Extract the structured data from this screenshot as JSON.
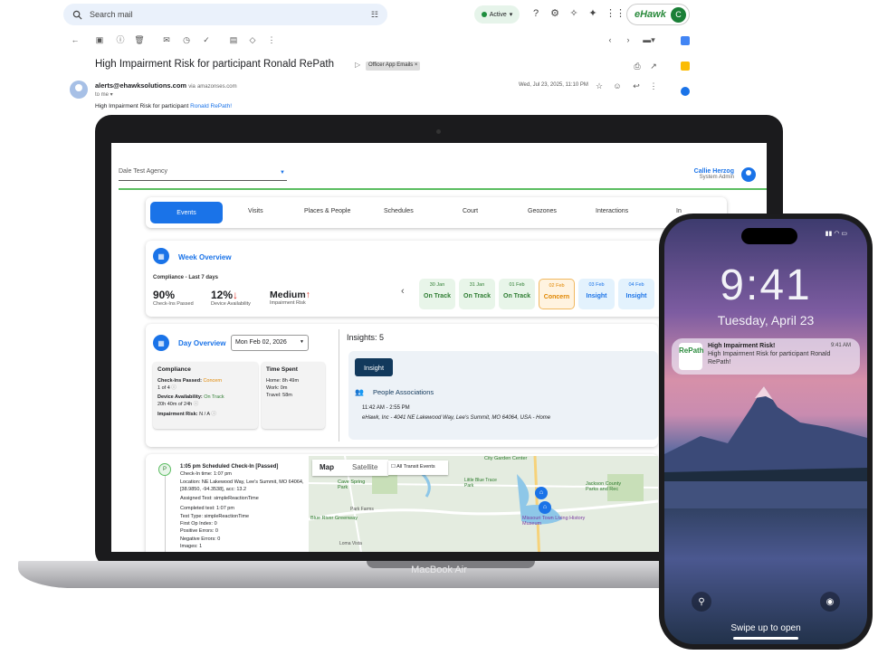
{
  "gmail": {
    "search_placeholder": "Search mail",
    "status": "Active",
    "account_logo": "eHawk",
    "account_initial": "C",
    "subject": "High Impairment Risk for participant  Ronald RePath",
    "label_chip": "Officer App Emails ×",
    "sender": "alerts@ehawksolutions.com",
    "via": "via",
    "via_domain": "amazonses.com",
    "to": "to me ▾",
    "date": "Wed, Jul 23, 2025, 11:10 PM",
    "body_text": "High Impairment Risk for participant ",
    "body_link": "Ronald RePath!"
  },
  "laptop": {
    "label": "MacBook Air",
    "agency": "Dale Test Agency",
    "user_name": "Callie Herzog",
    "user_role": "System Admin",
    "tabs": [
      "Events",
      "Visits",
      "Places & People",
      "Schedules",
      "Court",
      "Geozones",
      "Interactions",
      "In"
    ],
    "week": {
      "title": "Week Overview",
      "compliance_label": "Compliance - Last 7 days",
      "stats": [
        {
          "value": "90%",
          "label": "Check-Ins Passed"
        },
        {
          "value": "12%",
          "arrow": "↓",
          "label": "Device Availability"
        },
        {
          "value": "Medium",
          "arrow": "↑",
          "label": "Impairment Risk"
        }
      ],
      "days": [
        {
          "date": "30 Jan",
          "status": "On Track"
        },
        {
          "date": "31 Jan",
          "status": "On Track"
        },
        {
          "date": "01 Feb",
          "status": "On Track"
        },
        {
          "date": "02 Feb",
          "status": "Concern"
        },
        {
          "date": "03 Feb",
          "status": "Insight"
        },
        {
          "date": "04 Feb",
          "status": "Insight"
        }
      ]
    },
    "day": {
      "title": "Day Overview",
      "date": "Mon Feb 02, 2026",
      "compliance_title": "Compliance",
      "checkins_label": "Check-Ins Passed: ",
      "checkins_value": "Concern",
      "checkins_count": "1 of 4",
      "device_label": "Device Availability: ",
      "device_value": "On Track",
      "device_hours": "20h 40m of 24h",
      "risk_label": "Impairment Risk:",
      "risk_value": "N / A",
      "time_title": "Time Spent",
      "home": "Home: 8h 49m",
      "work": "Work: 0m",
      "travel": "Travel: 58m"
    },
    "insights": {
      "title": "Insights: 5",
      "button": "Insight",
      "section": "People Associations",
      "time": "11:42 AM - 2:55 PM",
      "place": "eHawk, Inc - 4041 NE Lakewood Way, Lee's Summit, MO 64064, USA - Home"
    },
    "event": {
      "title": "1:05 pm  Scheduled Check-In [Passed]",
      "checkin_time": "Check-In time: 1:07 pm",
      "location": "Location: NE Lakewood Way, Lee's Summit, MO 64064, [38.9850, -94.3538], acc: 13.2",
      "assigned": "Assigned Test: simpleReactionTime",
      "completed": "Completed test: 1:07 pm",
      "test_type": "Test Type: simpleReactionTime",
      "first_op": "First Op Index: 0",
      "positive": "Positive Errors: 0",
      "negative": "Negative Errors: 0",
      "images": "Images: 1"
    },
    "map": {
      "tab_map": "Map",
      "tab_satellite": "Satellite",
      "transit": "All Transit Events",
      "labels": [
        "City Garden Center",
        "Cave Spring Park",
        "Little Blue Trace Park",
        "Jackson County Parks and Rec",
        "Blue River Greenway",
        "Park Farms",
        "Missouri Town Living History Museum",
        "Loma Vista"
      ]
    }
  },
  "phone": {
    "time": "9:41",
    "date": "Tuesday, April 23",
    "notif_logo": "RePath",
    "notif_title": "High Impairment Risk!",
    "notif_time": "9:41 AM",
    "notif_body": "High Impairment Risk for participant Ronald RePath!",
    "swipe": "Swipe up to open"
  },
  "colors": {
    "accent": "#1a73e8",
    "ok": "#2e7d32",
    "concern": "#e08600",
    "brand_green": "#5bbd61"
  }
}
